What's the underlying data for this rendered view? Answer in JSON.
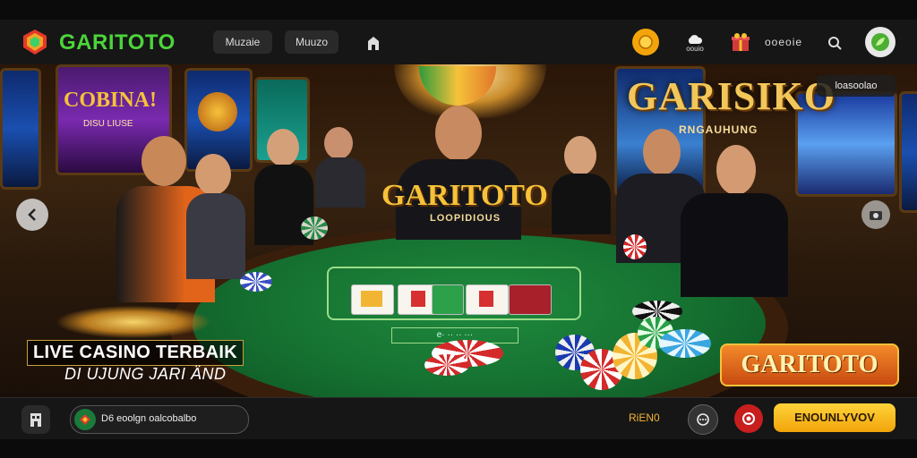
{
  "brand": {
    "name": "GARITOTO"
  },
  "nav": {
    "items": [
      {
        "label": "Muzaie"
      },
      {
        "label": "Muuzo"
      }
    ]
  },
  "header": {
    "coin_label": "oouio",
    "counter_label": "ooeoie"
  },
  "scene": {
    "top_right_badge": "loasoolao",
    "slot_left_title": "COBINA!",
    "slot_left_sub": "DISU LIUSE",
    "center_logo": "GARITOTO",
    "center_sub": "LOOPIDIOUS",
    "big_logo": "GARISIKO",
    "big_logo_sub": "RNGAUHUNG",
    "tagline_line1": "LIVE CASINO TERBAIK",
    "tagline_line2": "DI UJUNG JARI ÄND",
    "table_line": "e· ·· ·· ···",
    "cta_badge": "GARITOTO"
  },
  "footer": {
    "promo_text": "D6 eoolgn oalcobalbo",
    "link_label": "RiEN0",
    "button_label": "ENOUNLYVOV"
  },
  "colors": {
    "brand_green": "#4cd43a",
    "gold": "#f2b533",
    "felt": "#157030",
    "orange": "#e2641b"
  }
}
